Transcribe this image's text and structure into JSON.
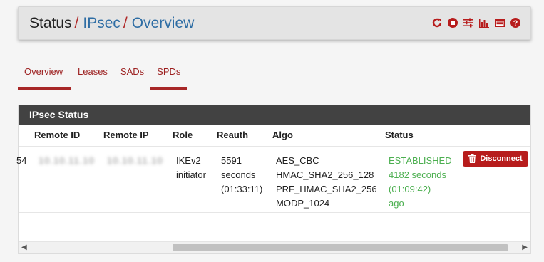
{
  "breadcrumb": {
    "status": "Status",
    "ipsec": "IPsec",
    "overview": "Overview",
    "sep": "/"
  },
  "header_icons": [
    "restart-icon",
    "stop-icon",
    "settings-sliders-icon",
    "chart-icon",
    "log-icon",
    "help-icon"
  ],
  "tabs": [
    {
      "label": "Overview",
      "active": true
    },
    {
      "label": "Leases"
    },
    {
      "label": "SADs"
    },
    {
      "label": "SPDs",
      "active": true
    }
  ],
  "panel": {
    "title": "IPsec Status"
  },
  "table": {
    "headers": [
      "Remote ID",
      "Remote IP",
      "Role",
      "Reauth",
      "Algo",
      "Status"
    ],
    "row": {
      "id_fragment": "54",
      "remote_id": "10.10.11.10",
      "remote_ip": "10.10.11.10",
      "role_1": "IKEv2",
      "role_2": "initiator",
      "reauth_1": "5591",
      "reauth_2": "seconds",
      "reauth_3": "(01:33:11)",
      "algo_1": "AES_CBC",
      "algo_2": "HMAC_SHA2_256_128",
      "algo_3": "PRF_HMAC_SHA2_256",
      "algo_4": "MODP_1024",
      "status_1": "ESTABLISHED",
      "status_2": "4182 seconds",
      "status_3": "(01:09:42)",
      "status_4": "ago",
      "button": "Disconnect"
    }
  },
  "colors": {
    "accent": "#b71c1c",
    "link": "#2e6da4",
    "heading": "#424242",
    "established": "#4caf50"
  }
}
